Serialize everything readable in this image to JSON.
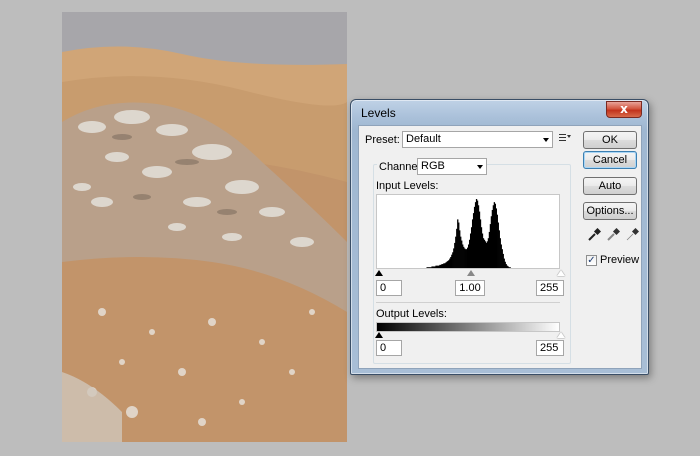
{
  "dialog": {
    "title": "Levels",
    "close_glyph": "x",
    "preset_label": "Preset:",
    "preset_value": "Default",
    "channel_label": "Channel:",
    "channel_value": "RGB",
    "input_levels_label": "Input Levels:",
    "input_levels": {
      "black": "0",
      "gamma": "1.00",
      "white": "255"
    },
    "output_levels_label": "Output Levels:",
    "output_levels": {
      "black": "0",
      "white": "255"
    },
    "buttons": {
      "ok": "OK",
      "cancel": "Cancel",
      "auto": "Auto",
      "options": "Options..."
    },
    "preview_label": "Preview",
    "preview_checked": true,
    "preview_check_glyph": "✓",
    "icons": [
      "preset-menu-icon",
      "black-eyedropper-icon",
      "gray-eyedropper-icon",
      "white-eyedropper-icon"
    ]
  },
  "histogram": {
    "description_bins": [
      0,
      0,
      0,
      0,
      0,
      0,
      0,
      0,
      0,
      0,
      0,
      0,
      0,
      0,
      0,
      0,
      0,
      0,
      0,
      0,
      0,
      0,
      0,
      0,
      0,
      0,
      0,
      0,
      0,
      0,
      0,
      0,
      0,
      0,
      0,
      0,
      0,
      0,
      0,
      0,
      0,
      0,
      0,
      0,
      0,
      0,
      0,
      0,
      0,
      0,
      1,
      1,
      1,
      1,
      1,
      2,
      2,
      2,
      2,
      3,
      3,
      3,
      3,
      4,
      4,
      5,
      5,
      6,
      6,
      7,
      8,
      9,
      10,
      12,
      14,
      17,
      20,
      25,
      32,
      40,
      50,
      62,
      58,
      48,
      40,
      35,
      30,
      27,
      25,
      24,
      24,
      26,
      30,
      36,
      44,
      52,
      62,
      70,
      78,
      84,
      88,
      86,
      80,
      72,
      62,
      52,
      44,
      38,
      36,
      34,
      32,
      34,
      38,
      46,
      56,
      66,
      74,
      80,
      84,
      82,
      76,
      68,
      58,
      48,
      38,
      30,
      24,
      18,
      12,
      8,
      5,
      3,
      2,
      1,
      1,
      0,
      0,
      0,
      0,
      0,
      0,
      0,
      0,
      0,
      0,
      0,
      0,
      0,
      0,
      0,
      0,
      0,
      0,
      0,
      0,
      0,
      0,
      0,
      0,
      0,
      0,
      0,
      0,
      0,
      0,
      0,
      0,
      0,
      0,
      0,
      0,
      0,
      0,
      0,
      0,
      0,
      0,
      0,
      0,
      0,
      0,
      0,
      0,
      0
    ]
  }
}
